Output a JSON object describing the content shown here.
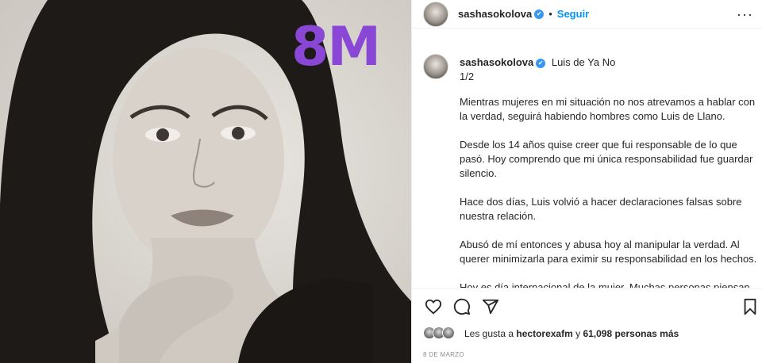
{
  "photo": {
    "badge": "8M",
    "badge_color": "#8a47d6",
    "description_icon": "portrait-photo"
  },
  "header": {
    "username": "sashasokolova",
    "verified": "✔",
    "separator": "•",
    "follow_label": "Seguir",
    "more": "···"
  },
  "caption": {
    "username": "sashasokolova",
    "title": "Luis de Ya No",
    "subtitle": "1/2",
    "paragraphs": [
      "Mientras mujeres en mi situación no nos atrevamos a hablar con la verdad, seguirá habiendo hombres como Luis de Llano.",
      "Desde los 14 años quise creer que fui responsable de lo que pasó. Hoy comprendo que mi única responsabilidad fue guardar silencio.",
      "Hace dos días, Luis volvió a hacer declaraciones falsas sobre nuestra relación.",
      "Abusó de mí entonces y abusa hoy al manipular la verdad. Al querer minimizarla para eximir su responsabilidad en los hechos.",
      "Hoy es día internacional de la mujer. Muchas personas piensan que es un día para felicitarnos. No es así."
    ]
  },
  "actions": {
    "like_icon": "heart-icon",
    "comment_icon": "comment-icon",
    "share_icon": "send-icon",
    "save_icon": "bookmark-icon"
  },
  "likes": {
    "prefix": "Les gusta a ",
    "user": "hectorexafm",
    "middle": " y ",
    "count": "61,098 personas más"
  },
  "date": "8 DE MARZO",
  "accent_color": "#0095f6"
}
